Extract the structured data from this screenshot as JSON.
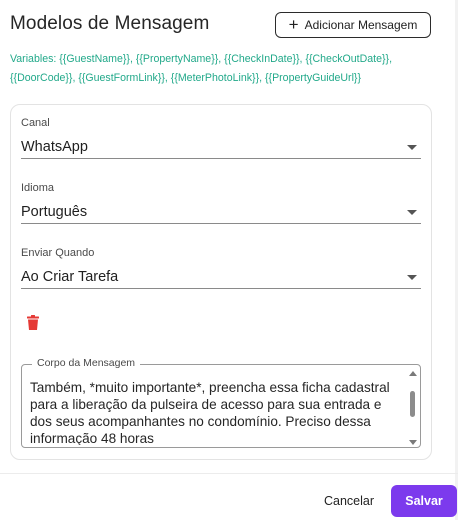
{
  "header": {
    "title": "Modelos de Mensagem",
    "add_button_label": "Adicionar Mensagem"
  },
  "variables_text": "Variables: {{GuestName}}, {{PropertyName}}, {{CheckInDate}}, {{CheckOutDate}}, {{DoorCode}}, {{GuestFormLink}}, {{MeterPhotoLink}}, {{PropertyGuideUrl}}",
  "form": {
    "channel": {
      "label": "Canal",
      "value": "WhatsApp"
    },
    "language": {
      "label": "Idioma",
      "value": "Português"
    },
    "send_when": {
      "label": "Enviar Quando",
      "value": "Ao Criar Tarefa"
    },
    "message_body": {
      "label": "Corpo da Mensagem",
      "value": "Também, *muito importante*, preencha essa ficha cadastral para a liberação da pulseira de acesso para sua entrada e dos seus acompanhantes no condomínio. Preciso dessa informação 48 horas"
    }
  },
  "footer": {
    "cancel_label": "Cancelar",
    "save_label": "Salvar"
  },
  "colors": {
    "accent": "#7c3aed",
    "variables": "#22a98a",
    "delete": "#e53935"
  },
  "icons": [
    "plus-icon",
    "chevron-down-icon",
    "trash-icon"
  ]
}
